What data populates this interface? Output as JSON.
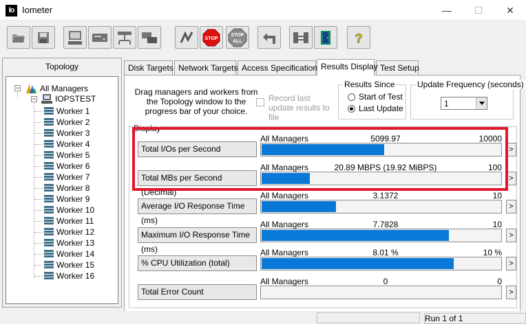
{
  "window": {
    "title": "Iometer",
    "icon_text": "Io",
    "minimize": "—",
    "maximize": "☐",
    "close": "✕"
  },
  "toolbar": {
    "buttons": [
      "open-icon",
      "save-icon",
      "new-worker-icon",
      "new-disk-worker-icon",
      "new-network-worker-icon",
      "duplicate-worker-icon",
      "start-icon",
      "stop-icon",
      "stop-all-icon",
      "reset-workers-icon",
      "disconnect-icon",
      "exit-icon",
      "about-icon"
    ],
    "stop_label": "STOP",
    "stop_all_top": "STOP",
    "stop_all_bottom": "ALL",
    "help_label": "?"
  },
  "topology": {
    "header": "Topology",
    "root": "All Managers",
    "manager": "IOPSTEST",
    "workers": [
      "Worker 1",
      "Worker 2",
      "Worker 3",
      "Worker 4",
      "Worker 5",
      "Worker 6",
      "Worker 7",
      "Worker 8",
      "Worker 9",
      "Worker 10",
      "Worker 11",
      "Worker 12",
      "Worker 13",
      "Worker 14",
      "Worker 15",
      "Worker 16"
    ],
    "expander": "−"
  },
  "tabs": [
    "Disk Targets",
    "Network Targets",
    "Access Specifications",
    "Results Display",
    "Test Setup"
  ],
  "active_tab": "Results Display",
  "results": {
    "drag_text": "Drag managers and workers from the Topology window to the progress bar of your choice.",
    "record_label": "Record last update results to file",
    "since_title": "Results Since",
    "since_options": [
      "Start of Test",
      "Last Update"
    ],
    "since_selected": "Last Update",
    "freq_title": "Update Frequency (seconds)",
    "freq_value": "1",
    "display_title": "Display"
  },
  "metrics": [
    {
      "label": "Total I/Os per Second",
      "source": "All Managers",
      "value": "5099.97",
      "max": "10000",
      "fill": 0.51
    },
    {
      "label": "Total MBs per Second (Decimal)",
      "source": "All Managers",
      "value": "20.89 MBPS (19.92 MiBPS)",
      "max": "100",
      "fill": 0.2
    },
    {
      "label": "Average I/O Response Time (ms)",
      "source": "All Managers",
      "value": "3.1372",
      "max": "10",
      "fill": 0.31
    },
    {
      "label": "Maximum I/O Response Time (ms)",
      "source": "All Managers",
      "value": "7.7828",
      "max": "10",
      "fill": 0.78
    },
    {
      "label": "% CPU Utilization (total)",
      "source": "All Managers",
      "value": "8.01 %",
      "max": "10 %",
      "fill": 0.8
    },
    {
      "label": "Total Error Count",
      "source": "All Managers",
      "value": "0",
      "max": "0",
      "fill": 0
    }
  ],
  "arrow_label": ">",
  "status": {
    "run": "Run 1 of 1"
  },
  "colors": {
    "bar": "#0a78d7",
    "highlight": "#e0172b"
  }
}
